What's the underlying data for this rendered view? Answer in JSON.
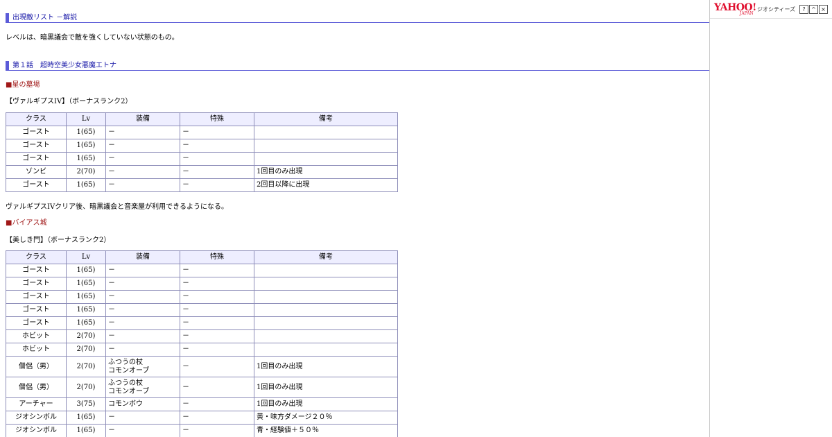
{
  "section1": {
    "heading": "出現敵リスト －解説",
    "note": "レベルは、暗黒議会で敵を強くしていない状態のもの。"
  },
  "section2": {
    "heading": "第１話　超時空美少女悪魔エトナ"
  },
  "places": [
    {
      "name": "■星の墓場",
      "map": "【ヴァルギプスIV】（ボーナスランク2）",
      "after_note": "ヴァルギプスIVクリア後、暗黒議会と音楽屋が利用できるようになる。"
    },
    {
      "name": "■バイアス城",
      "map": "【美しき門】（ボーナスランク2）"
    }
  ],
  "table_headers": [
    "クラス",
    "Lv",
    "装備",
    "特殊",
    "備考"
  ],
  "table1": [
    [
      "ゴースト",
      "1(65)",
      "－",
      "－",
      ""
    ],
    [
      "ゴースト",
      "1(65)",
      "－",
      "－",
      ""
    ],
    [
      "ゴースト",
      "1(65)",
      "－",
      "－",
      ""
    ],
    [
      "ゾンビ",
      "2(70)",
      "－",
      "－",
      "1回目のみ出現"
    ],
    [
      "ゴースト",
      "1(65)",
      "－",
      "－",
      "2回目以降に出現"
    ]
  ],
  "table2": [
    [
      "ゴースト",
      "1(65)",
      "－",
      "－",
      ""
    ],
    [
      "ゴースト",
      "1(65)",
      "－",
      "－",
      ""
    ],
    [
      "ゴースト",
      "1(65)",
      "－",
      "－",
      ""
    ],
    [
      "ゴースト",
      "1(65)",
      "－",
      "－",
      ""
    ],
    [
      "ゴースト",
      "1(65)",
      "－",
      "－",
      ""
    ],
    [
      "ホビット",
      "2(70)",
      "－",
      "－",
      ""
    ],
    [
      "ホビット",
      "2(70)",
      "－",
      "－",
      ""
    ],
    [
      "僧侶（男）",
      "2(70)",
      "ふつうの杖\nコモンオーブ",
      "－",
      "1回目のみ出現"
    ],
    [
      "僧侶（男）",
      "2(70)",
      "ふつうの杖\nコモンオーブ",
      "－",
      "1回目のみ出現"
    ],
    [
      "アーチャー",
      "3(75)",
      "コモンボウ",
      "－",
      "1回目のみ出現"
    ],
    [
      "ジオシンボル",
      "1(65)",
      "－",
      "－",
      "黄・味方ダメージ２０％"
    ],
    [
      "ジオシンボル",
      "1(65)",
      "－",
      "－",
      "青・経験値＋５０％"
    ]
  ],
  "sidebar": {
    "logo_text": "YAHOO!",
    "logo_sub": "JAPAN",
    "service": "ジオシティーズ",
    "help_label": "?",
    "collapse_label": "^",
    "close_label": "×"
  }
}
